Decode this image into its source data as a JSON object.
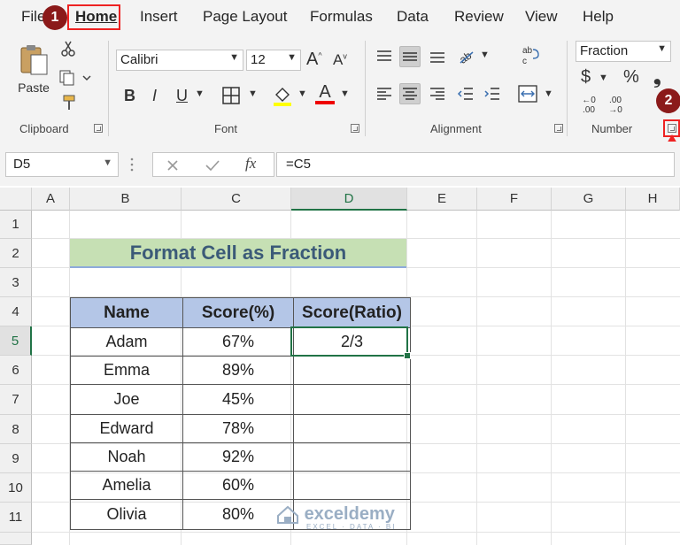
{
  "menu": {
    "items": [
      "File",
      "Home",
      "Insert",
      "Page Layout",
      "Formulas",
      "Data",
      "Review",
      "View",
      "Help"
    ],
    "badge1": "1",
    "badge2": "2"
  },
  "ribbon": {
    "clipboard": {
      "paste_label": "Paste",
      "group_label": "Clipboard"
    },
    "font": {
      "font_name": "Calibri",
      "font_size": "12",
      "bold": "B",
      "italic": "I",
      "underline": "U",
      "grow": "A",
      "shrink": "A",
      "font_color": "A",
      "group_label": "Font"
    },
    "alignment": {
      "group_label": "Alignment"
    },
    "number": {
      "format_value": "Fraction",
      "currency": "$",
      "percent": "%",
      "comma": "❟",
      "inc_decimal": "←0 .00",
      "dec_decimal": ".00 →0",
      "group_label": "Number"
    }
  },
  "formula_bar": {
    "name_box": "D5",
    "fx_label": "fx",
    "formula": "=C5"
  },
  "grid": {
    "columns": [
      "A",
      "B",
      "C",
      "D",
      "E",
      "F",
      "G",
      "H"
    ],
    "rows": [
      "1",
      "2",
      "3",
      "4",
      "5",
      "6",
      "7",
      "8",
      "9",
      "10",
      "11"
    ],
    "title": "Format Cell as Fraction",
    "headers": [
      "Name",
      "Score(%)",
      "Score(Ratio)"
    ],
    "data": [
      [
        "Adam",
        "67%",
        "2/3"
      ],
      [
        "Emma",
        "89%",
        ""
      ],
      [
        "Joe",
        "45%",
        ""
      ],
      [
        "Edward",
        "78%",
        ""
      ],
      [
        "Noah",
        "92%",
        ""
      ],
      [
        "Amelia",
        "60%",
        ""
      ],
      [
        "Olivia",
        "80%",
        ""
      ]
    ]
  },
  "watermark": {
    "name": "exceldemy",
    "tagline": "EXCEL · DATA · BI"
  },
  "colors": {
    "accent": "#217346",
    "header_fill": "#b4c6e7",
    "title_fill": "#c6e0b4",
    "badge": "#8b1a1a",
    "highlight": "#e22222"
  }
}
